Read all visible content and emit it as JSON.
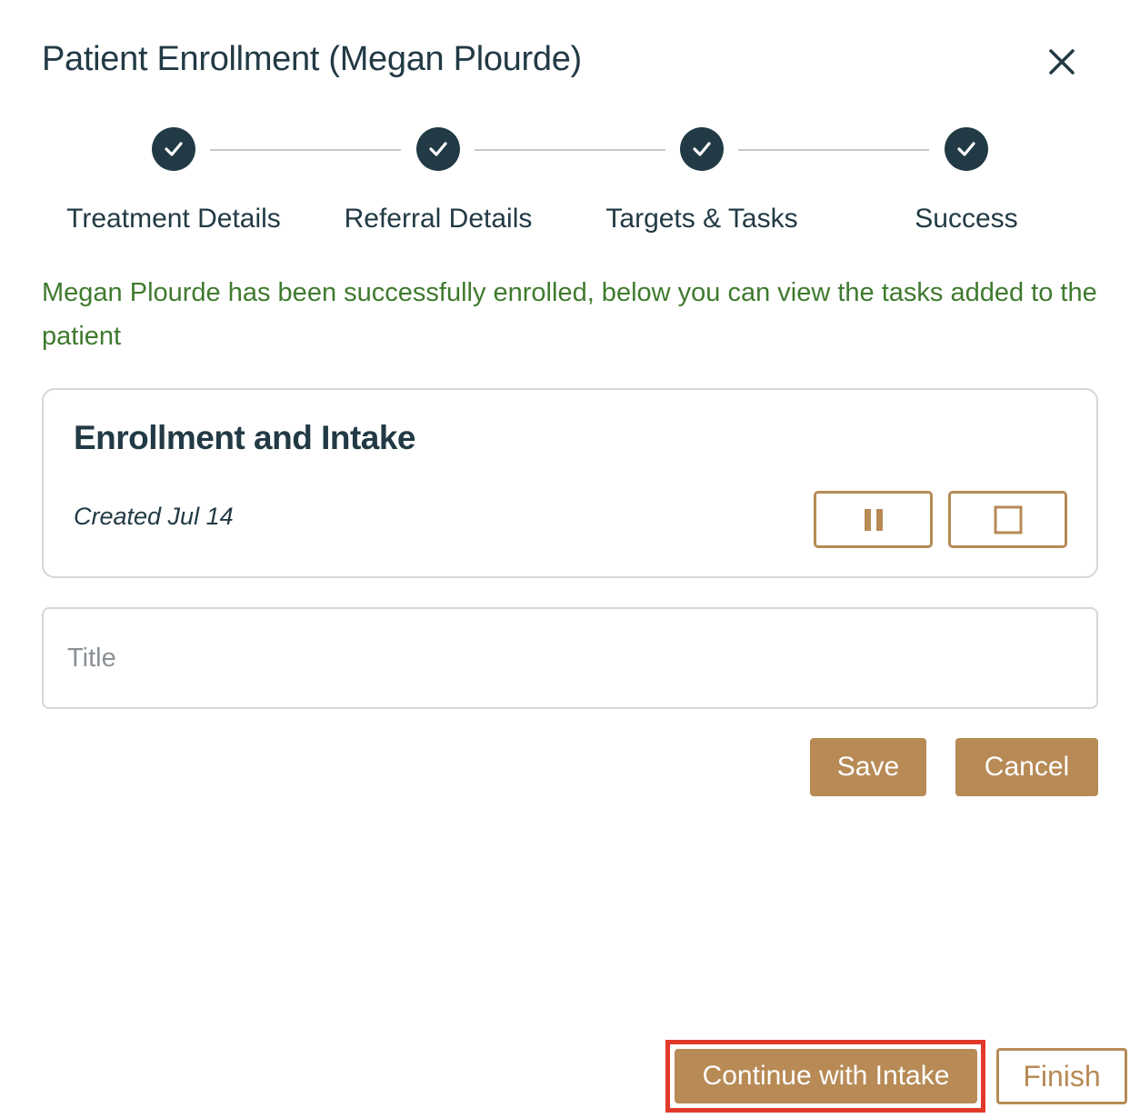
{
  "modal": {
    "title": "Patient Enrollment (Megan Plourde)",
    "close_icon": "close-icon"
  },
  "stepper": {
    "steps": [
      {
        "label": "Treatment Details",
        "status": "complete",
        "icon": "check-icon"
      },
      {
        "label": "Referral Details",
        "status": "complete",
        "icon": "check-icon"
      },
      {
        "label": "Targets & Tasks",
        "status": "complete",
        "icon": "check-icon"
      },
      {
        "label": "Success",
        "status": "complete",
        "icon": "check-icon"
      }
    ]
  },
  "success_message": "Megan Plourde has been successfully enrolled, below you can view the tasks added to the patient",
  "task": {
    "title": "Enrollment and Intake",
    "created": "Created Jul 14",
    "pause_icon": "pause-icon",
    "stop_icon": "stop-icon"
  },
  "title_input": {
    "value": "",
    "placeholder": "Title"
  },
  "form_actions": {
    "save_label": "Save",
    "cancel_label": "Cancel"
  },
  "footer": {
    "continue_label": "Continue with Intake",
    "finish_label": "Finish"
  },
  "colors": {
    "primary_dark": "#223a45",
    "accent": "#b78a56",
    "success_text": "#3f7a2e",
    "highlight": "#e23a2a"
  }
}
